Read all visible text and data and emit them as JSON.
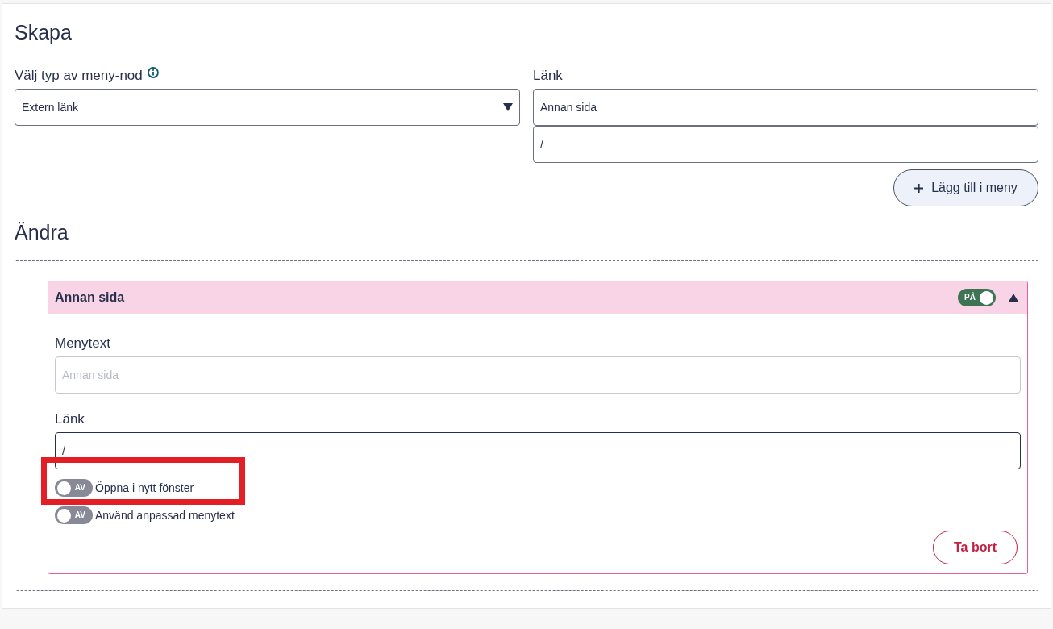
{
  "create": {
    "heading": "Skapa",
    "type_select": {
      "label": "Välj typ av meny-nod",
      "value": "Extern länk"
    },
    "link": {
      "label": "Länk",
      "fields": [
        {
          "value": "Annan sida"
        },
        {
          "value": "/"
        }
      ]
    },
    "add_button": "Lägg till i meny"
  },
  "edit": {
    "heading": "Ändra",
    "items": [
      {
        "title": "Annan sida",
        "toggle": {
          "on": true,
          "label": "PÅ"
        },
        "expanded": true,
        "menu_text": {
          "label": "Menytext",
          "placeholder": "Annan sida"
        },
        "link": {
          "label": "Länk",
          "value": "/"
        },
        "options": [
          {
            "label": "Öppna i nytt fönster",
            "on": false,
            "switch_label": "AV",
            "highlighted": true
          },
          {
            "label": "Använd anpassad menytext",
            "on": false,
            "switch_label": "AV",
            "highlighted": false
          }
        ],
        "delete_button": "Ta bort"
      }
    ]
  }
}
